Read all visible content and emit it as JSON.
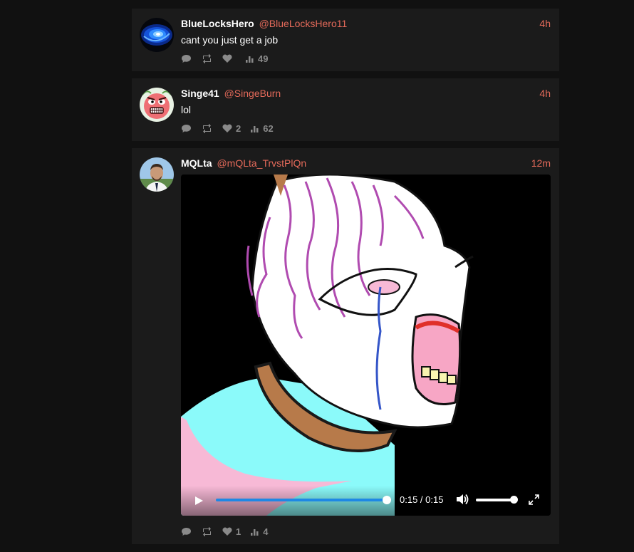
{
  "posts": [
    {
      "name": "BlueLocksHero",
      "handle": "@BlueLocksHero11",
      "time": "4h",
      "text": "cant you just get a job",
      "likes": "",
      "views": "49",
      "avatar_icon": "blue-swirl-avatar"
    },
    {
      "name": "Singe41",
      "handle": "@SingeBurn",
      "time": "4h",
      "text": "lol",
      "likes": "2",
      "views": "62",
      "avatar_icon": "angry-pink-face-avatar"
    },
    {
      "name": "MQLta",
      "handle": "@mQLta_TrvstPlQn",
      "time": "12m",
      "text": "",
      "likes": "1",
      "views": "4",
      "avatar_icon": "man-portrait-avatar",
      "video": {
        "time_display": "0:15 / 0:15",
        "progress": 1.0,
        "volume": 1.0
      }
    }
  ],
  "colors": {
    "background": "#111111",
    "card": "#1b1b1b",
    "accent": "#e46a5a",
    "muted": "#8a8a8a",
    "progress": "#1e88e5"
  }
}
